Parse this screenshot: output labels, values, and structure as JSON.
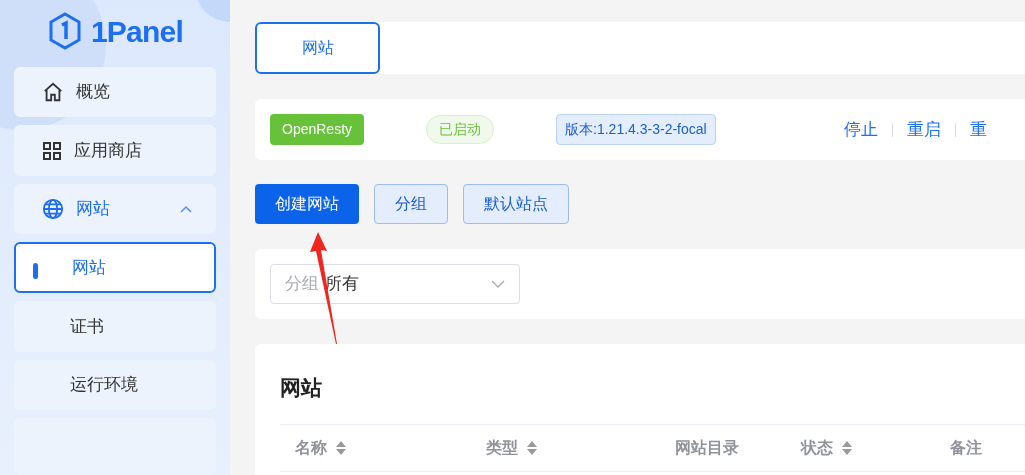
{
  "logo": {
    "text": "1Panel"
  },
  "sidebar": {
    "items": [
      {
        "label": "概览",
        "selected": false
      },
      {
        "label": "应用商店",
        "selected": false
      },
      {
        "label": "网站",
        "selected": true,
        "expanded": true,
        "children": [
          {
            "label": "网站",
            "selected": true
          },
          {
            "label": "证书",
            "selected": false
          },
          {
            "label": "运行环境",
            "selected": false
          }
        ]
      }
    ]
  },
  "tabs": [
    {
      "label": "网站",
      "selected": true
    }
  ],
  "status_card": {
    "app": "OpenResty",
    "status": "已启动",
    "version": "版本:1.21.4.3-3-2-focal",
    "actions": [
      "停止",
      "重启",
      "重"
    ]
  },
  "buttons": [
    {
      "label": "创建网站",
      "kind": "primary"
    },
    {
      "label": "分组",
      "kind": "plain"
    },
    {
      "label": "默认站点",
      "kind": "plain"
    }
  ],
  "filter": {
    "label": "分组",
    "value": "所有"
  },
  "table": {
    "title": "网站",
    "columns": [
      {
        "label": "名称",
        "sortable": true
      },
      {
        "label": "类型",
        "sortable": true
      },
      {
        "label": "网站目录",
        "sortable": false
      },
      {
        "label": "状态",
        "sortable": true
      },
      {
        "label": "备注",
        "sortable": false
      }
    ]
  }
}
